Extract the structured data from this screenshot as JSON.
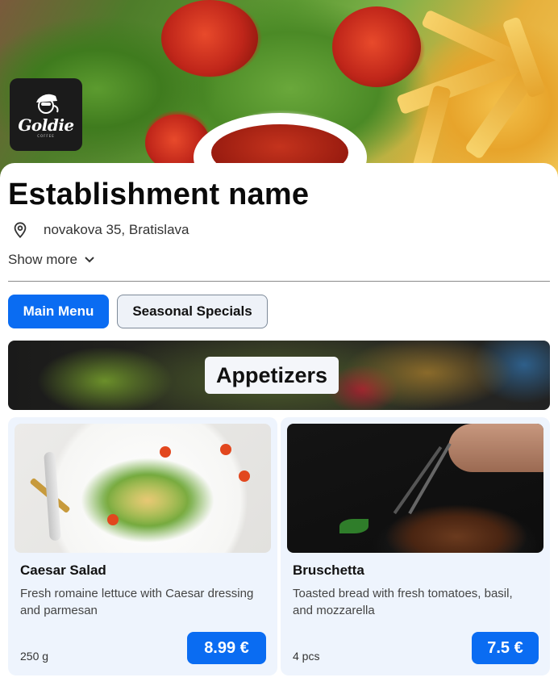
{
  "brand": {
    "logo_text": "Goldie",
    "logo_subtext": "COFFEE"
  },
  "establishment": {
    "name": "Establishment name",
    "address": "novakova 35, Bratislava",
    "show_more_label": "Show more"
  },
  "tabs": [
    {
      "label": "Main Menu",
      "active": true
    },
    {
      "label": "Seasonal Specials",
      "active": false
    }
  ],
  "section": {
    "title": "Appetizers"
  },
  "items": [
    {
      "name": "Caesar Salad",
      "description": "Fresh romaine lettuce with Caesar dressing and parmesan",
      "quantity": "250 g",
      "price": "8.99 €"
    },
    {
      "name": "Bruschetta",
      "description": "Toasted bread with fresh tomatoes, basil, and mozzarella",
      "quantity": "4 pcs",
      "price": "7.5 €"
    }
  ],
  "colors": {
    "accent": "#0a6cf2",
    "card_background": "#eef4fd",
    "tab_inactive_background": "#eef2f8"
  },
  "icons": {
    "location": "location-pin-icon",
    "chevron": "chevron-down-icon"
  }
}
